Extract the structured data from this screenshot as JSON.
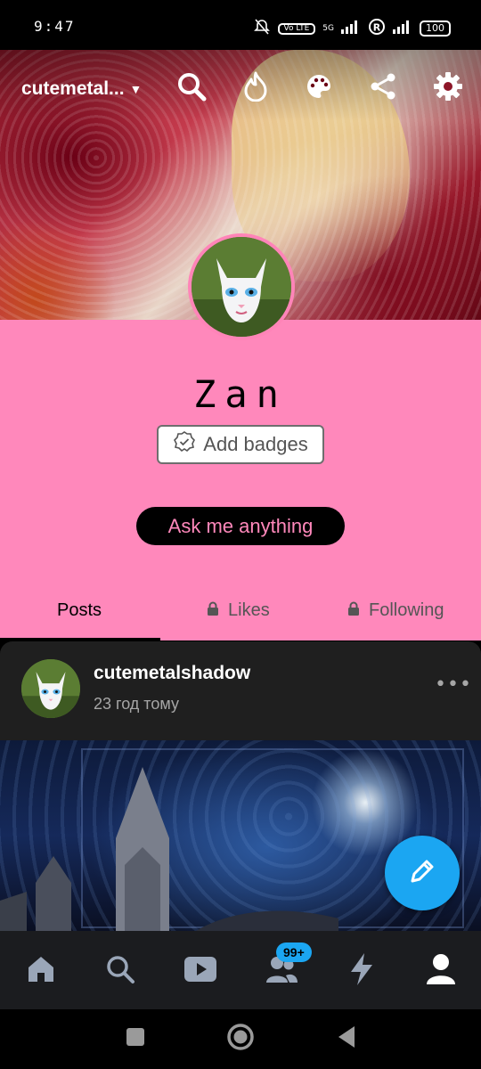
{
  "status_bar": {
    "time": "9:47",
    "volte_label": "Vo LTE",
    "network_label": "5G",
    "battery": "100"
  },
  "header": {
    "blog_name": "cutemetal...",
    "icons": [
      "search-icon",
      "fire-icon",
      "palette-icon",
      "share-icon",
      "gear-icon"
    ]
  },
  "profile": {
    "title": "Zan",
    "badges_label": "Add badges",
    "ask_label": "Ask me anything",
    "tabs": {
      "posts": "Posts",
      "likes": "Likes",
      "following": "Following"
    },
    "colors": {
      "background": "#ff88bb",
      "accent": "#000000"
    }
  },
  "post": {
    "username": "cutemetalshadow",
    "time": "23 год тому"
  },
  "bottom_nav": {
    "items": [
      "home-icon",
      "search-icon",
      "video-icon",
      "community-icon",
      "activity-icon",
      "account-icon"
    ],
    "badge": "99+"
  },
  "fab": {
    "icon": "pencil-icon",
    "color": "#1ba6f2"
  }
}
